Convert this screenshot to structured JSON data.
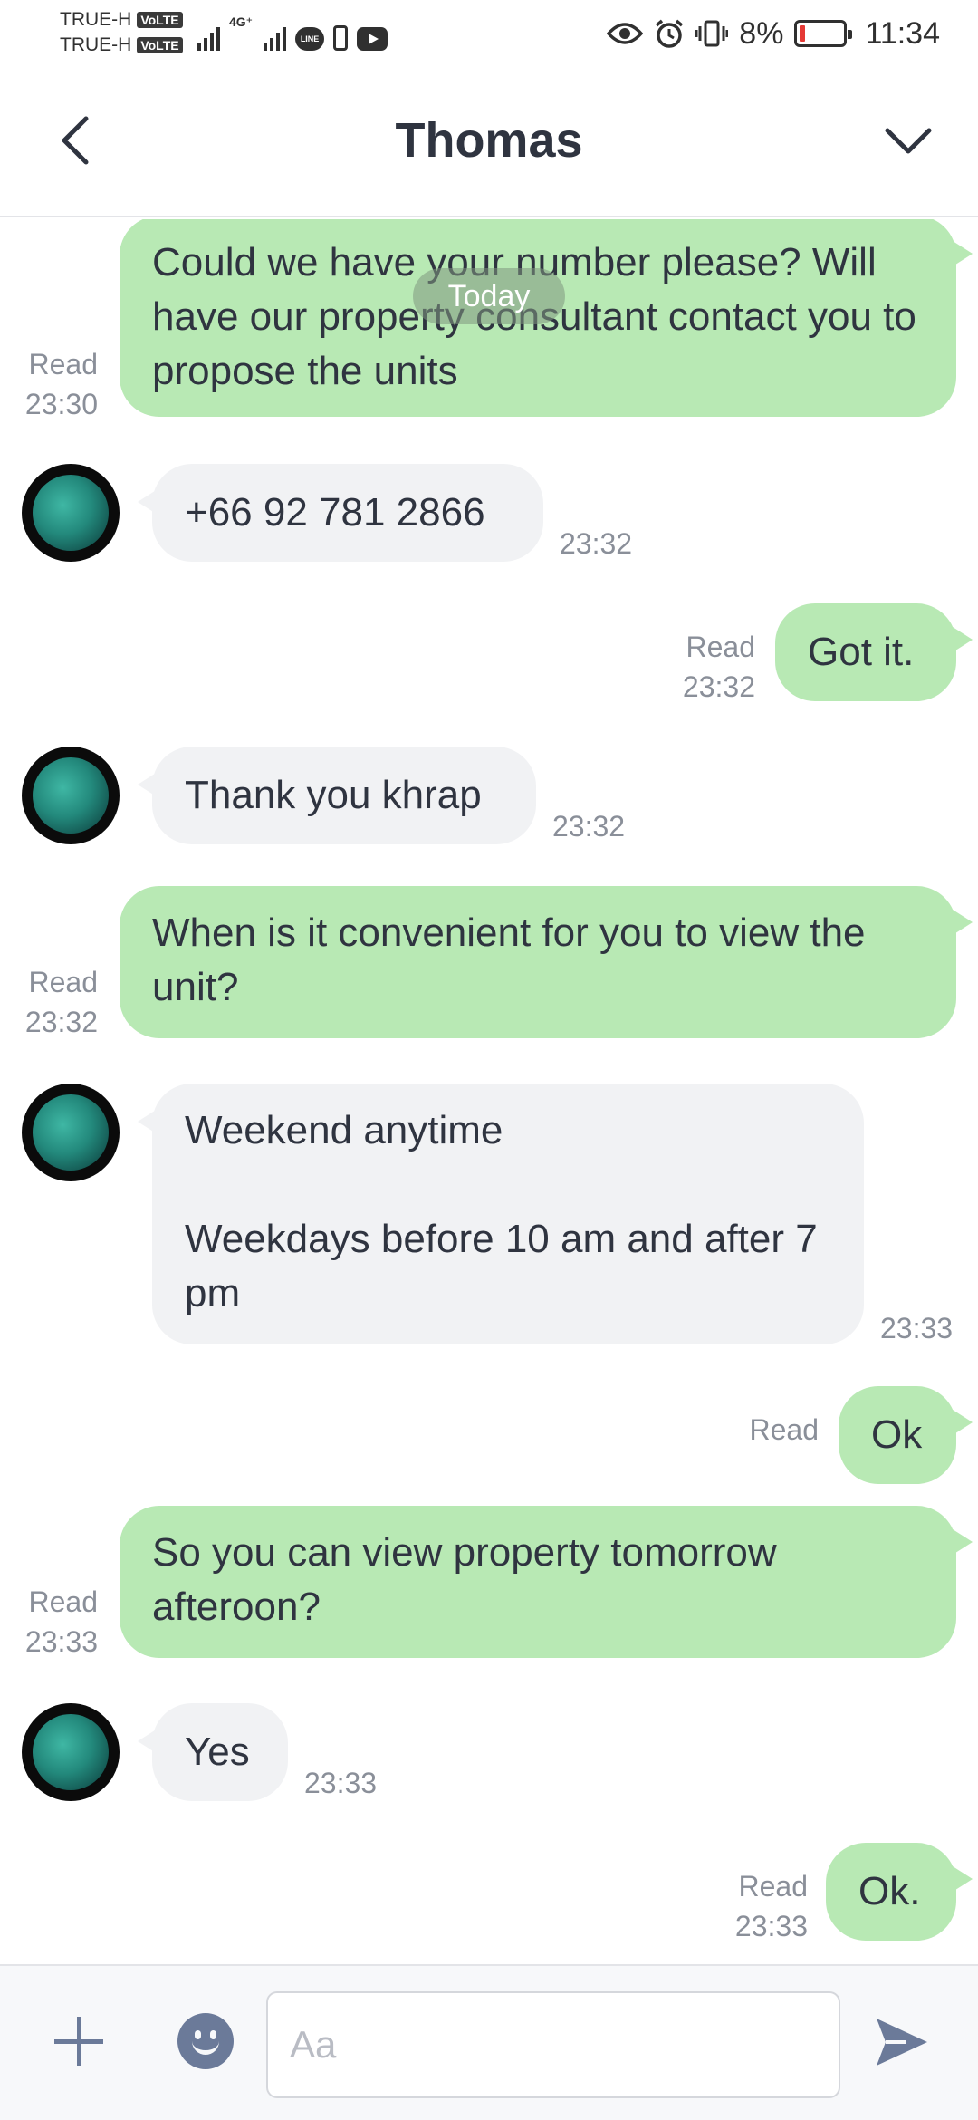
{
  "status_bar": {
    "carrier_1": "TRUE-H",
    "carrier_2": "TRUE-H",
    "volte_badge": "VoLTE",
    "network_label": "4G⁺",
    "line_icon_text": "LINE",
    "battery": "8%",
    "time": "11:34",
    "battery_color": "#e53935"
  },
  "header": {
    "title": "Thomas",
    "back_icon": "chevron-left-icon",
    "menu_icon": "chevron-down-icon"
  },
  "date_separator": "Today",
  "messages": [
    {
      "side": "out",
      "text": "Could we have your number please? Will have our property consultant contact you to propose the units",
      "status": "Read",
      "time": "23:30"
    },
    {
      "side": "in",
      "text": "+66 92 781 2866",
      "time": "23:32"
    },
    {
      "side": "out",
      "text": "Got it.",
      "status": "Read",
      "time": "23:32"
    },
    {
      "side": "in",
      "text": "Thank you khrap",
      "time": "23:32"
    },
    {
      "side": "out",
      "text": "When is it convenient for you to view the unit?",
      "status": "Read",
      "time": "23:32"
    },
    {
      "side": "in",
      "text": "Weekend anytime\n\nWeekdays before 10 am and after 7 pm",
      "time": "23:33"
    },
    {
      "side": "out",
      "text": "Ok",
      "status": "Read",
      "time": ""
    },
    {
      "side": "out",
      "text": "So you can view property tomorrow afteroon?",
      "status": "Read",
      "time": "23:33"
    },
    {
      "side": "in",
      "text": "Yes",
      "time": "23:33"
    },
    {
      "side": "out",
      "text": "Ok.",
      "status": "Read",
      "time": "23:33"
    }
  ],
  "input_bar": {
    "placeholder": "Aa",
    "value": "",
    "plus_icon": "plus-icon",
    "emoji_icon": "emoji-icon",
    "send_icon": "send-icon"
  },
  "colors": {
    "outgoing_bubble": "#b8e9b4",
    "incoming_bubble": "#f1f2f4",
    "accent_icon": "#6b7a99"
  }
}
